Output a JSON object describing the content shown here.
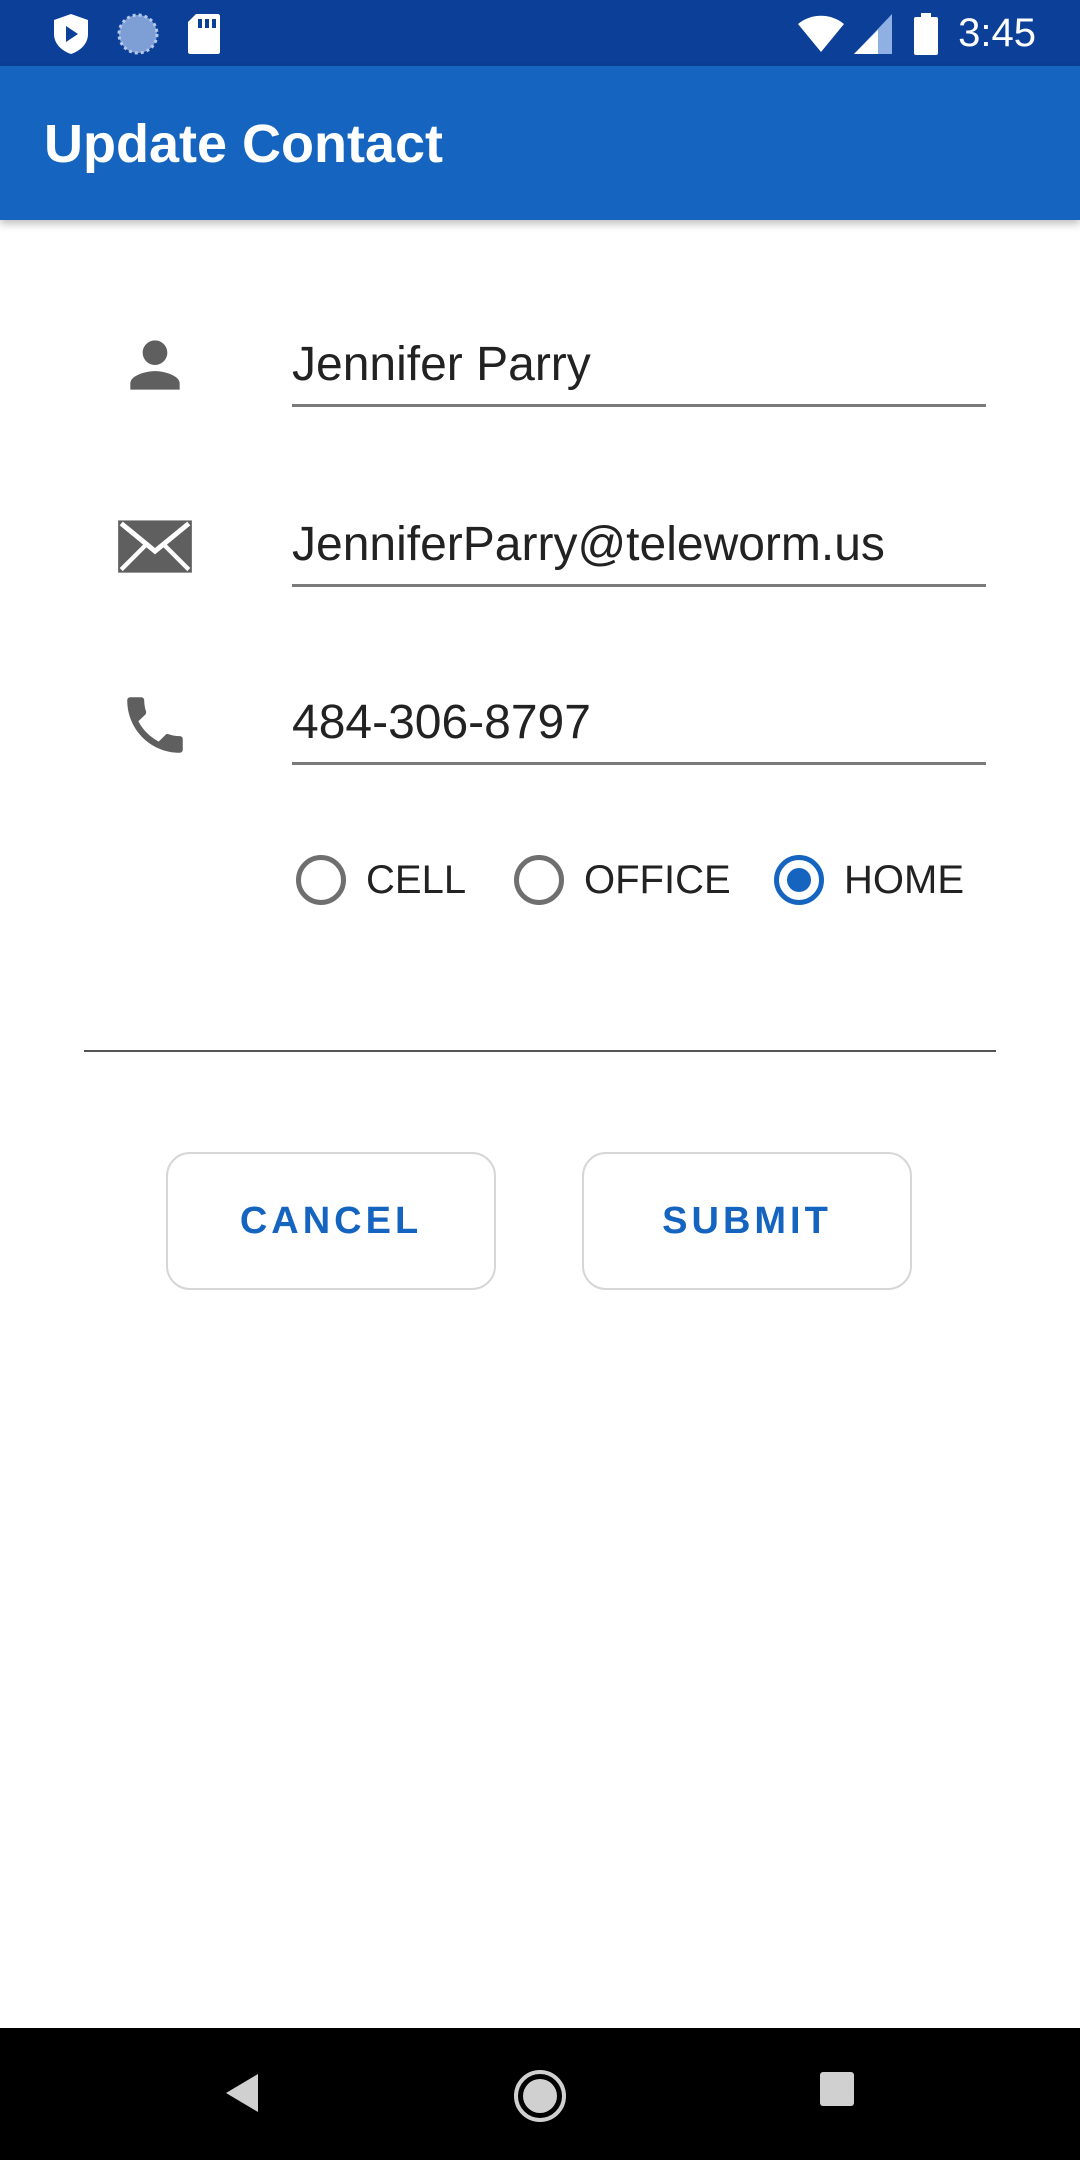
{
  "status_bar": {
    "time": "3:45",
    "left_icons": [
      "shield-icon",
      "sync-icon",
      "sd-card-icon"
    ],
    "right_icons": [
      "wifi-icon",
      "signal-icon",
      "battery-icon"
    ]
  },
  "app_bar": {
    "title": "Update Contact",
    "color": "#1565c0"
  },
  "form": {
    "name": {
      "icon": "person-icon",
      "value": "Jennifer Parry"
    },
    "email": {
      "icon": "mail-icon",
      "value": "JenniferParry@teleworm.us"
    },
    "phone": {
      "icon": "phone-icon",
      "value": "484-306-8797"
    },
    "phone_type": {
      "options": [
        {
          "label": "CELL",
          "checked": false
        },
        {
          "label": "OFFICE",
          "checked": false
        },
        {
          "label": "HOME",
          "checked": true
        }
      ],
      "selected": "HOME"
    }
  },
  "actions": {
    "cancel_label": "CANCEL",
    "submit_label": "SUBMIT",
    "accent": "#1565c0"
  },
  "nav_bar": {
    "icons": [
      "back-icon",
      "home-icon",
      "recents-icon"
    ]
  }
}
